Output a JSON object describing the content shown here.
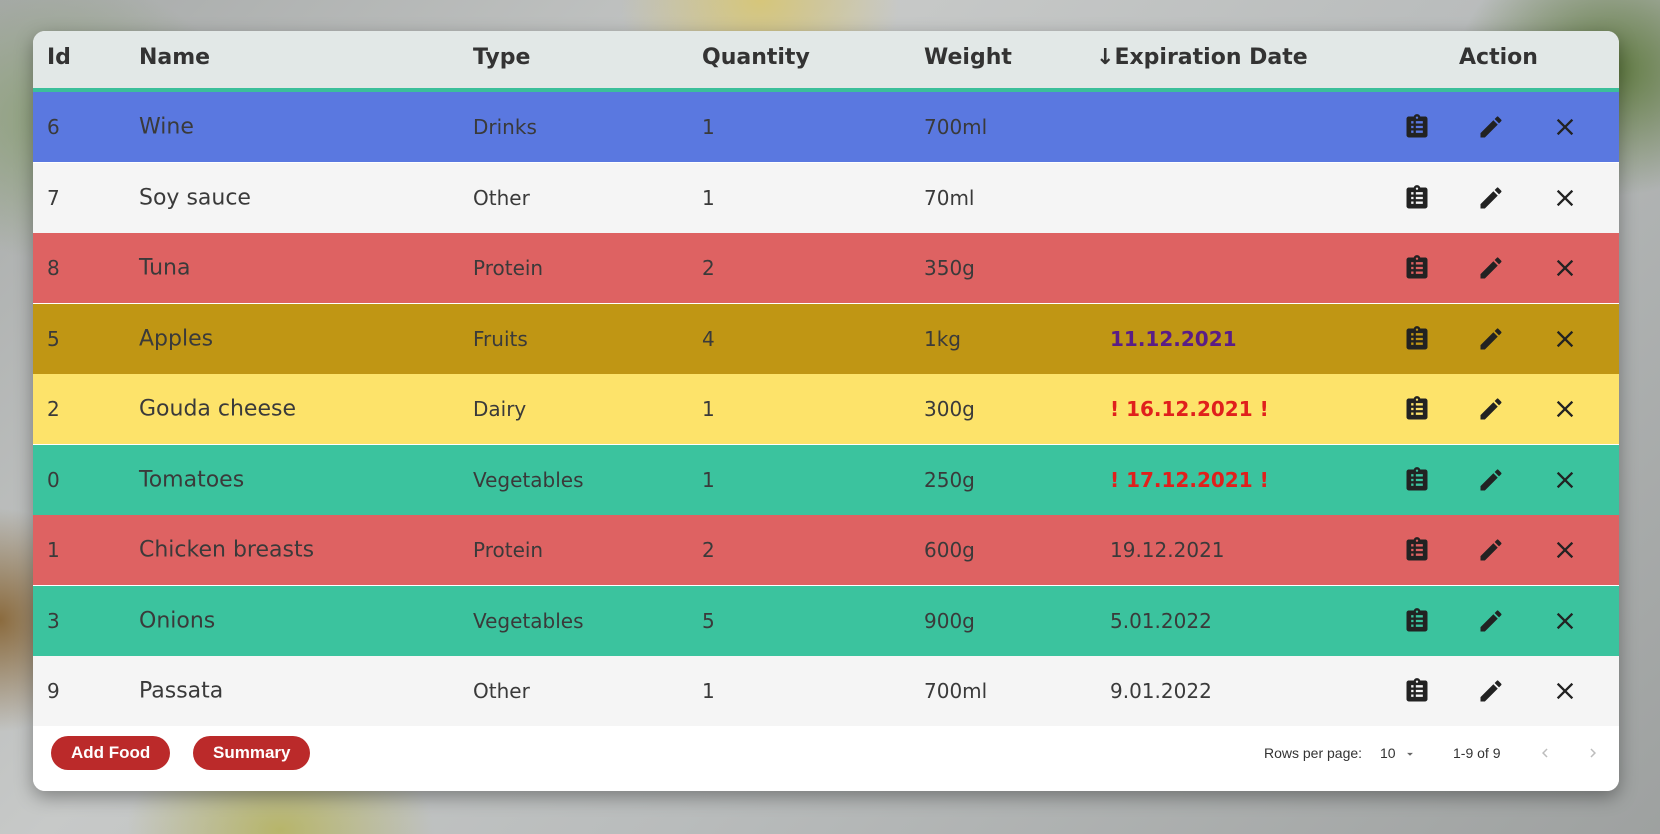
{
  "table": {
    "headers": {
      "id": "Id",
      "name": "Name",
      "type": "Type",
      "quantity": "Quantity",
      "weight": "Weight",
      "sort_arrow": "↓",
      "expiration": "Expiration Date",
      "action": "Action"
    },
    "rows": [
      {
        "id": "6",
        "name": "Wine",
        "type": "Drinks",
        "quantity": "1",
        "weight": "700ml",
        "expiration": "",
        "bg": "#5a78e0",
        "exp_color": "#3a3a3a"
      },
      {
        "id": "7",
        "name": "Soy sauce",
        "type": "Other",
        "quantity": "1",
        "weight": "70ml",
        "expiration": "",
        "bg": "#f5f5f5",
        "exp_color": "#3a3a3a"
      },
      {
        "id": "8",
        "name": "Tuna",
        "type": "Protein",
        "quantity": "2",
        "weight": "350g",
        "expiration": "",
        "bg": "#de6262",
        "exp_color": "#3a3a3a"
      },
      {
        "id": "5",
        "name": "Apples",
        "type": "Fruits",
        "quantity": "4",
        "weight": "1kg",
        "expiration": "11.12.2021",
        "bg": "#c09614",
        "exp_color": "#5a1d86"
      },
      {
        "id": "2",
        "name": "Gouda cheese",
        "type": "Dairy",
        "quantity": "1",
        "weight": "300g",
        "expiration": "! 16.12.2021 !",
        "bg": "#fde36a",
        "exp_color": "#e0201c"
      },
      {
        "id": "0",
        "name": "Tomatoes",
        "type": "Vegetables",
        "quantity": "1",
        "weight": "250g",
        "expiration": "! 17.12.2021 !",
        "bg": "#3bc39e",
        "exp_color": "#e0201c"
      },
      {
        "id": "1",
        "name": "Chicken breasts",
        "type": "Protein",
        "quantity": "2",
        "weight": "600g",
        "expiration": "19.12.2021",
        "bg": "#de6262",
        "exp_color": "#3a3a3a"
      },
      {
        "id": "3",
        "name": "Onions",
        "type": "Vegetables",
        "quantity": "5",
        "weight": "900g",
        "expiration": "5.01.2022",
        "bg": "#3bc39e",
        "exp_color": "#3a3a3a"
      },
      {
        "id": "9",
        "name": "Passata",
        "type": "Other",
        "quantity": "1",
        "weight": "700ml",
        "expiration": "9.01.2022",
        "bg": "#f5f5f5",
        "exp_color": "#3a3a3a"
      }
    ],
    "row_icons": [
      "clipboard-list-icon",
      "pencil-icon",
      "close-icon"
    ]
  },
  "footer": {
    "add_food_label": "Add Food",
    "summary_label": "Summary",
    "rows_per_page_label": "Rows per page:",
    "rows_per_page_value": "10",
    "page_range": "1-9 of 9"
  },
  "colors": {
    "header_bg": "#e2e8e7",
    "header_accent": "#3bbf9a",
    "button_bg": "#bb2a2a"
  }
}
